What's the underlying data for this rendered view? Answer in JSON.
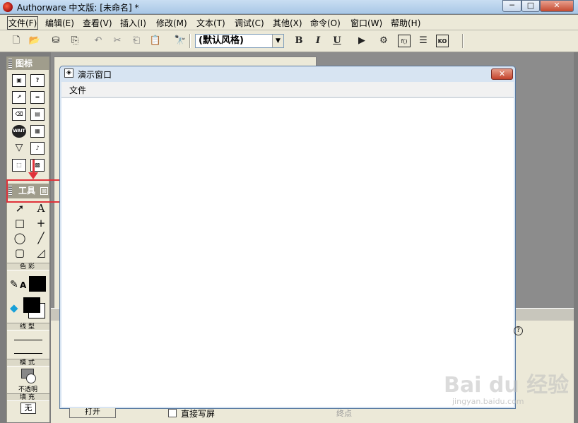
{
  "window": {
    "title": "Authorware 中文版: [未命名] *",
    "minimize": "─",
    "maximize": "□",
    "close": "✕"
  },
  "menu": [
    "文件(F)",
    "编辑(E)",
    "查看(V)",
    "插入(I)",
    "修改(M)",
    "文本(T)",
    "调试(C)",
    "其他(X)",
    "命令(O)",
    "窗口(W)",
    "帮助(H)"
  ],
  "toolbar": {
    "style_value": "(默认风格)",
    "bold": "B",
    "italic": "I",
    "underline": "U",
    "dropdown_arrow": "▼"
  },
  "icon_palette": {
    "title": "图标",
    "icons": [
      "display-icon",
      "interaction-icon",
      "motion-icon",
      "calculation-icon",
      "erase-icon",
      "map-icon",
      "wait-icon",
      "digital-movie-icon",
      "navigate-icon",
      "sound-icon",
      "framework-icon",
      "video-icon",
      "decision-icon",
      "knowledge-object-icon"
    ],
    "wait_label": "WAIT"
  },
  "tools": {
    "title": "工具",
    "close": "⊠",
    "color_section": "色彩",
    "line_section": "线型",
    "mode_section": "模式",
    "mode_value": "不透明",
    "fill_section": "填充",
    "fill_value": "无",
    "text_tool": "A",
    "pen_text": "A"
  },
  "presentation": {
    "title": "演示窗口",
    "close": "✕",
    "menu_file": "文件",
    "icon_glyph": "◈"
  },
  "bottom": {
    "button_label": "打开",
    "checkbox_label": "直接写屏",
    "dim_label": "终点",
    "help": "?"
  },
  "watermark": {
    "text": "Bai du 经验",
    "url": "jingyan.baidu.com"
  }
}
